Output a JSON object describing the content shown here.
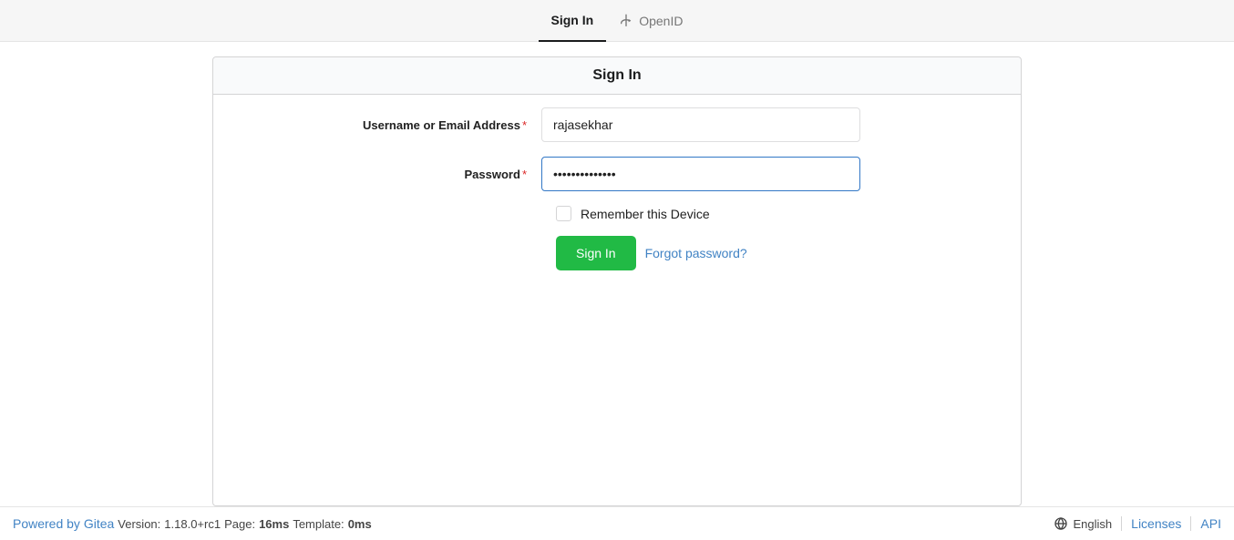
{
  "tabs": {
    "signin": "Sign In",
    "openid": "OpenID"
  },
  "panel": {
    "title": "Sign In"
  },
  "form": {
    "username_label": "Username or Email Address",
    "username_value": "rajasekhar",
    "password_label": "Password",
    "password_value": "••••••••••••••",
    "remember_label": "Remember this Device",
    "submit_label": "Sign In",
    "forgot_link": "Forgot password?"
  },
  "footer": {
    "powered": "Powered by Gitea",
    "version_label": "Version:",
    "version_value": "1.18.0+rc1",
    "page_label": "Page:",
    "page_value": "16ms",
    "template_label": "Template:",
    "template_value": "0ms",
    "language": "English",
    "licenses": "Licenses",
    "api": "API"
  }
}
